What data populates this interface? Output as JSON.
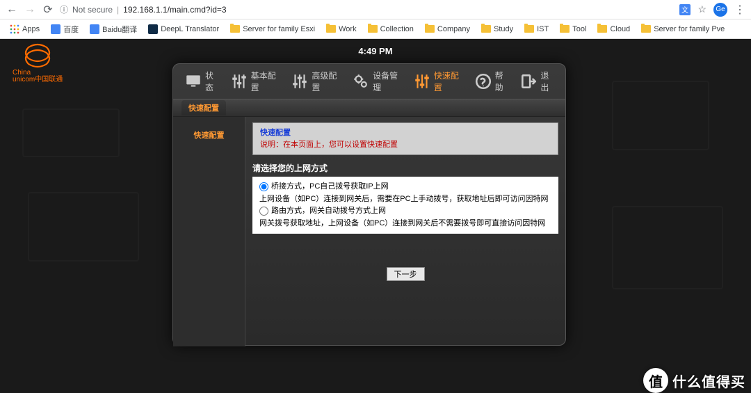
{
  "browser": {
    "not_secure": "Not secure",
    "url": "192.168.1.1/main.cmd?id=3",
    "apps": "Apps",
    "avatar": "Ge"
  },
  "bookmarks": [
    "百度",
    "Baidu翻译",
    "DeepL Translator",
    "Server for family Esxi",
    "Work",
    "Collection",
    "Company",
    "Study",
    "IST",
    "Tool",
    "Cloud",
    "Server for family Pve"
  ],
  "logo_text": "unicom中国联通",
  "logo_brand": "China",
  "time": "4:49 PM",
  "tabs": [
    {
      "label": "状态"
    },
    {
      "label": "基本配置"
    },
    {
      "label": "高级配置"
    },
    {
      "label": "设备管理"
    },
    {
      "label": "快速配置"
    },
    {
      "label": "帮助"
    },
    {
      "label": "退出"
    }
  ],
  "breadcrumb": "快速配置",
  "sidebar": {
    "item0": "快速配置"
  },
  "info": {
    "title": "快速配置",
    "desc": "说明：在本页面上，您可以设置快速配置"
  },
  "section_title": "请选择您的上网方式",
  "options": {
    "bridge_label": "桥接方式，PC自己拨号获取IP上网",
    "bridge_desc": "上网设备（如PC）连接到网关后，需要在PC上手动拨号，获取地址后即可访问因特网",
    "route_label": "路由方式，网关自动拨号方式上网",
    "route_desc": "网关拨号获取地址，上网设备（如PC）连接到网关后不需要拨号即可直接访问因特网"
  },
  "next_btn": "下一步",
  "watermark": {
    "circle": "值",
    "text": "什么值得买"
  }
}
